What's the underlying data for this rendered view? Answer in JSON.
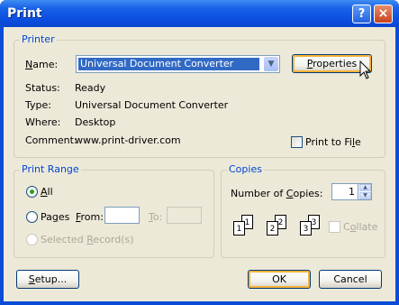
{
  "window": {
    "title": "Print",
    "help_icon": "?",
    "close_icon": "×"
  },
  "printer": {
    "group_title": "Printer",
    "name_label_pre": "",
    "name_label_ul": "N",
    "name_label_post": "ame:",
    "name_value": "Universal Document Converter",
    "properties_label_ul": "P",
    "properties_label_post": "roperties",
    "status_label": "Status:",
    "status_value": "Ready",
    "type_label": "Type:",
    "type_value": "Universal Document Converter",
    "where_label": "Where:",
    "where_value": "Desktop",
    "comment_label": "Comment:",
    "comment_value": "www.print-driver.com",
    "print_to_file_pre": "Print to Fi",
    "print_to_file_ul": "l",
    "print_to_file_post": "e",
    "print_to_file_checked": false
  },
  "print_range": {
    "group_title": "Print Range",
    "all_ul": "A",
    "all_post": "ll",
    "all_selected": true,
    "pages_pre": "Pa",
    "pages_ul": "g",
    "pages_post": "es",
    "from_ul": "F",
    "from_post": "rom:",
    "from_value": "",
    "to_ul": "T",
    "to_post": "o:",
    "to_value": "",
    "selected_record_pre": "Selected ",
    "selected_record_ul": "R",
    "selected_record_post": "ecord(s)"
  },
  "copies": {
    "group_title": "Copies",
    "number_label_pre": "Number of ",
    "number_label_ul": "C",
    "number_label_post": "opies:",
    "number_value": "1",
    "collate_pre": "C",
    "collate_ul": "o",
    "collate_post": "llate",
    "collate_checked": false,
    "collate_pages": [
      "1",
      "1",
      "2",
      "2",
      "3",
      "3"
    ]
  },
  "footer": {
    "setup_ul": "S",
    "setup_post": "etup...",
    "ok_label": "OK",
    "cancel_label": "Cancel"
  },
  "colors": {
    "title_bar": "#0a4bd8",
    "group_title": "#0046d5",
    "selection": "#316ac5",
    "dialog_bg": "#ece9d8"
  }
}
